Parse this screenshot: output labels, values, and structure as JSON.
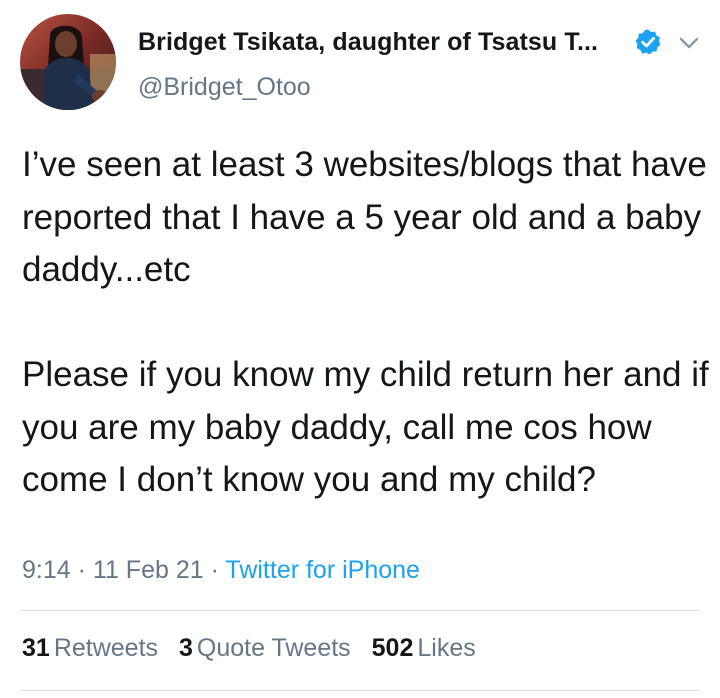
{
  "author": {
    "display_name": "Bridget Tsikata, daughter of Tsatsu T...",
    "handle": "@Bridget_Otoo",
    "verified": true,
    "avatar": "profile-photo"
  },
  "tweet": {
    "text": "I’ve seen at least 3 websites/blogs that have reported that I have a 5 year old and a baby daddy...etc\n\nPlease if you know my child return her and if you are my baby daddy, call me cos how come I don’t know you and my child?",
    "time": "9:14",
    "date": "11 Feb 21",
    "source": "Twitter for iPhone"
  },
  "stats": {
    "retweets_count": "31",
    "retweets_label": "Retweets",
    "quotes_count": "3",
    "quotes_label": "Quote Tweets",
    "likes_count": "502",
    "likes_label": "Likes"
  },
  "icons": {
    "verified": "verified-badge-icon",
    "menu": "chevron-down-icon"
  },
  "colors": {
    "text": "#14171a",
    "secondary": "#657786",
    "accent": "#1da1f2",
    "divider": "#d8dde1"
  }
}
